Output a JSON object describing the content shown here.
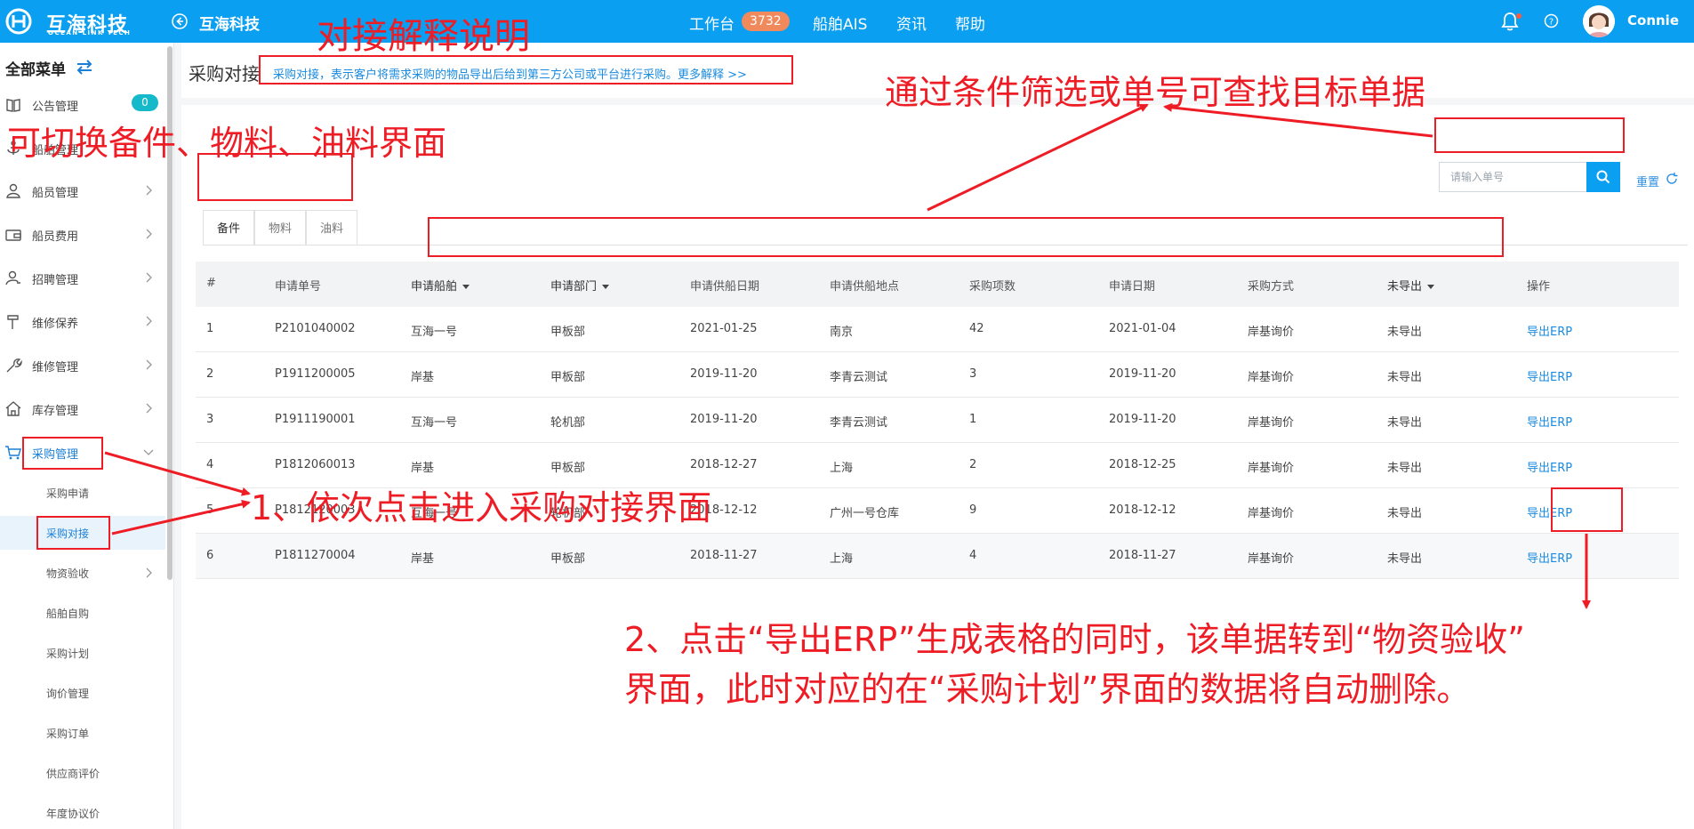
{
  "topbar": {
    "brand_name": "互海科技",
    "brand_sub": "OCEAN LINK TECH",
    "back_label": "互海科技",
    "nav": [
      {
        "label": "工作台"
      },
      {
        "label": "船舶AIS"
      },
      {
        "label": "资讯"
      },
      {
        "label": "帮助"
      }
    ],
    "workbench_badge": "3732",
    "username": "Connie"
  },
  "sidebar": {
    "heading": "全部菜单",
    "notice_count": "0",
    "items": [
      {
        "label": "公告管理",
        "icon": "book-icon"
      },
      {
        "label": "船舶管理",
        "icon": "anchor-icon"
      },
      {
        "label": "船员管理",
        "icon": "person-icon"
      },
      {
        "label": "船员费用",
        "icon": "wallet-icon"
      },
      {
        "label": "招聘管理",
        "icon": "recruit-icon"
      },
      {
        "label": "维修保养",
        "icon": "hammer-icon"
      },
      {
        "label": "维修管理",
        "icon": "wrench-icon"
      },
      {
        "label": "库存管理",
        "icon": "home-icon"
      },
      {
        "label": "采购管理",
        "icon": "cart-icon"
      }
    ],
    "sub_items": [
      {
        "label": "采购申请"
      },
      {
        "label": "采购对接"
      },
      {
        "label": "物资验收"
      },
      {
        "label": "船舶自购"
      },
      {
        "label": "采购计划"
      },
      {
        "label": "询价管理"
      },
      {
        "label": "采购订单"
      },
      {
        "label": "供应商评价"
      },
      {
        "label": "年度协议价"
      }
    ]
  },
  "page": {
    "title": "采购对接",
    "description": "采购对接，表示客户将需求采购的物品导出后给到第三方公司或平台进行采购。更多解释 >>",
    "search_placeholder": "请输入单号",
    "reset_label": "重置",
    "tabs": [
      {
        "label": "备件"
      },
      {
        "label": "物料"
      },
      {
        "label": "油料"
      }
    ]
  },
  "table": {
    "columns": [
      "#",
      "申请单号",
      "申请船舶",
      "申请部门",
      "申请供船日期",
      "申请供船地点",
      "采购项数",
      "申请日期",
      "采购方式",
      "未导出",
      "操作"
    ],
    "rows": [
      {
        "no": "1",
        "order": "P2101040002",
        "ship": "互海一号",
        "dept": "甲板部",
        "supply_date": "2021-01-25",
        "place": "南京",
        "items": "42",
        "apply_date": "2021-01-04",
        "method": "岸基询价",
        "status": "未导出",
        "action": "导出ERP"
      },
      {
        "no": "2",
        "order": "P1911200005",
        "ship": "岸基",
        "dept": "甲板部",
        "supply_date": "2019-11-20",
        "place": "李青云测试",
        "items": "3",
        "apply_date": "2019-11-20",
        "method": "岸基询价",
        "status": "未导出",
        "action": "导出ERP"
      },
      {
        "no": "3",
        "order": "P1911190001",
        "ship": "互海一号",
        "dept": "轮机部",
        "supply_date": "2019-11-20",
        "place": "李青云测试",
        "items": "1",
        "apply_date": "2019-11-20",
        "method": "岸基询价",
        "status": "未导出",
        "action": "导出ERP"
      },
      {
        "no": "4",
        "order": "P1812060013",
        "ship": "岸基",
        "dept": "甲板部",
        "supply_date": "2018-12-27",
        "place": "上海",
        "items": "2",
        "apply_date": "2018-12-25",
        "method": "岸基询价",
        "status": "未导出",
        "action": "导出ERP"
      },
      {
        "no": "5",
        "order": "P1812120003",
        "ship": "互海一号",
        "dept": "轮机部",
        "supply_date": "2018-12-12",
        "place": "广州一号仓库",
        "items": "9",
        "apply_date": "2018-12-12",
        "method": "岸基询价",
        "status": "未导出",
        "action": "导出ERP"
      },
      {
        "no": "6",
        "order": "P1811270004",
        "ship": "岸基",
        "dept": "甲板部",
        "supply_date": "2018-11-27",
        "place": "上海",
        "items": "4",
        "apply_date": "2018-11-27",
        "method": "岸基询价",
        "status": "未导出",
        "action": "导出ERP"
      }
    ]
  },
  "annotations": {
    "title_explain": "对接解释说明",
    "switch_tabs": "可切换备件、物料、油料界面",
    "filter_hint": "通过条件筛选或单号可查找目标单据",
    "step1": "1、依次点击进入采购对接界面",
    "step2_line1": "2、点击“导出ERP”生成表格的同时，该单据转到“物资验收”",
    "step2_line2": "界面，此时对应的在“采购计划”界面的数据将自动删除。"
  },
  "colors": {
    "brand": "#0a9ff0",
    "annotation": "#ee1c25",
    "link": "#1a8be0",
    "badge": "#f08a5d"
  }
}
